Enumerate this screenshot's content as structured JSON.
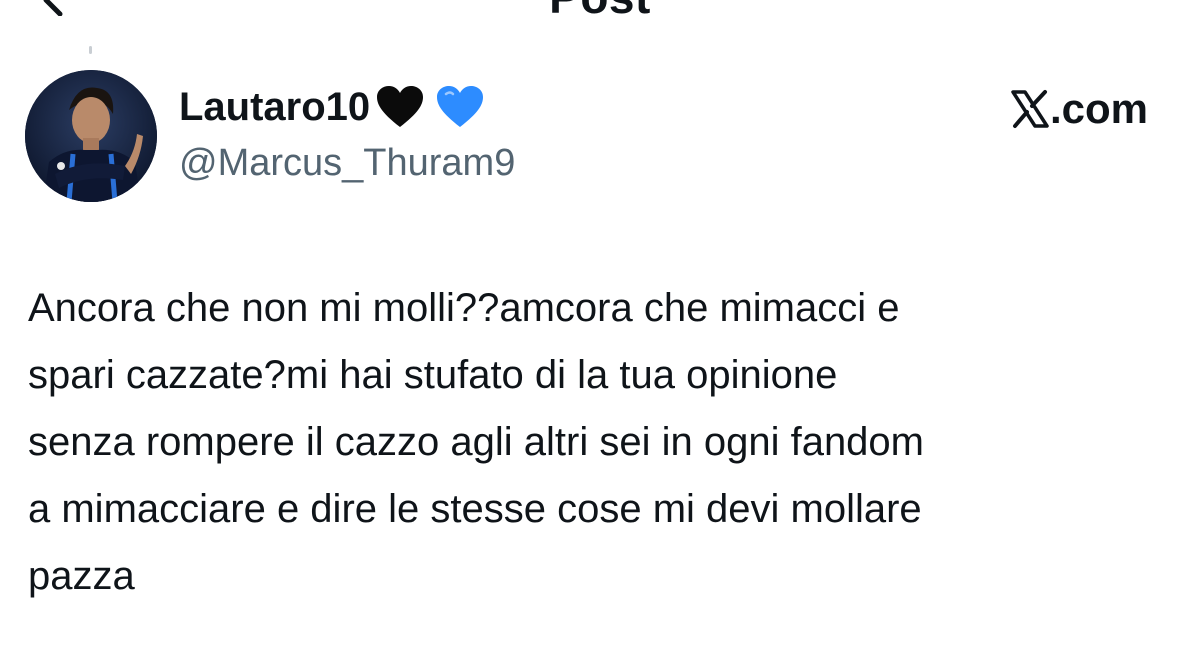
{
  "header": {
    "back_icon": "back-arrow-icon",
    "title": "Post"
  },
  "author": {
    "display_name": "Lautaro10",
    "emoji_hearts": [
      {
        "name": "black-heart-icon",
        "color": "#0b0b0b"
      },
      {
        "name": "blue-heart-icon",
        "color": "#2d8cff"
      }
    ],
    "handle": "@Marcus_Thuram9",
    "avatar_icon": "avatar"
  },
  "brand": {
    "logo": "x-logo-icon",
    "domain": ".com"
  },
  "tweet": {
    "lines": [
      "Ancora che non mi molli??amcora che mimacci e",
      "spari cazzate?mi hai stufato di la tua opinione",
      "senza rompere il cazzo agli altri sei in ogni fandom",
      "a mimacciare e dire le stesse cose mi devi mollare",
      "pazza"
    ]
  },
  "colors": {
    "text_primary": "#0f1419",
    "text_secondary": "#536471",
    "background": "#ffffff"
  }
}
